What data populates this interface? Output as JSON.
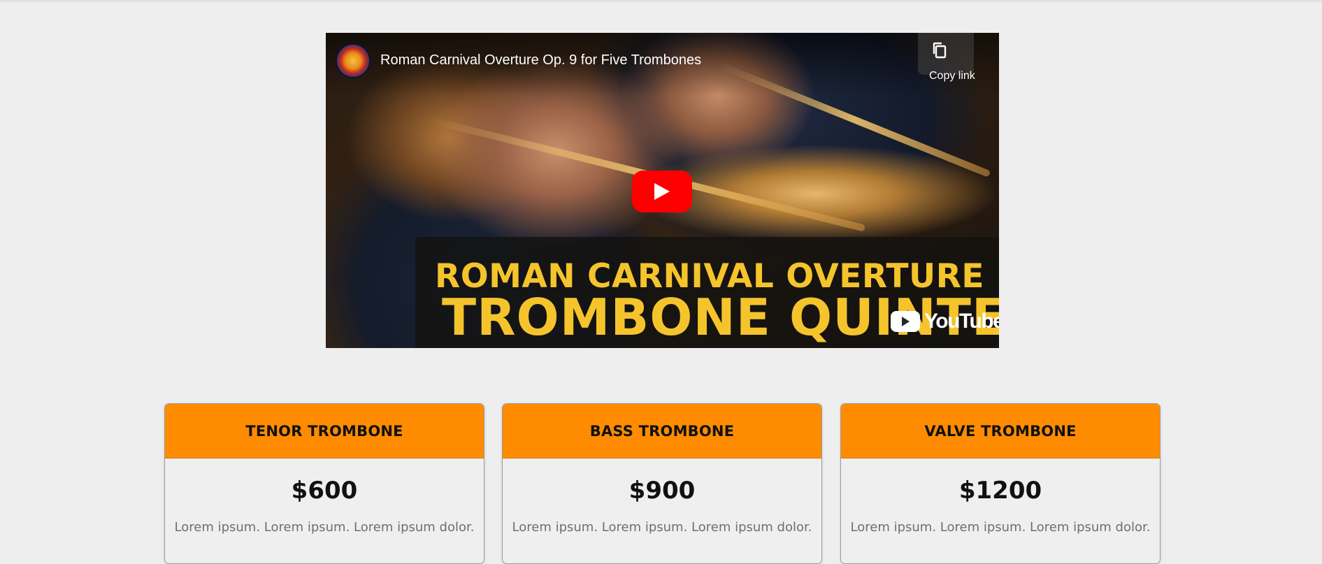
{
  "video": {
    "title": "Roman Carnival Overture Op. 9 for Five Trombones",
    "copy_link_label": "Copy link",
    "caption_line1": "ROMAN CARNIVAL OVERTURE",
    "caption_line2": "TROMBONE QUINTET",
    "youtube_wordmark": "YouTube",
    "icons": {
      "channel": "channel-logo",
      "copy": "copy-icon",
      "play": "play-icon",
      "youtube": "youtube-logo-icon"
    },
    "colors": {
      "play_button": "#ff0000",
      "caption_text": "#f5c42c"
    }
  },
  "pricing": {
    "colors": {
      "header": "#ff8c00",
      "card_background": "#efefef"
    },
    "cards": [
      {
        "name": "TENOR TROMBONE",
        "price": "$600",
        "description": "Lorem ipsum. Lorem ipsum. Lorem ipsum dolor."
      },
      {
        "name": "BASS TROMBONE",
        "price": "$900",
        "description": "Lorem ipsum. Lorem ipsum. Lorem ipsum dolor."
      },
      {
        "name": "VALVE TROMBONE",
        "price": "$1200",
        "description": "Lorem ipsum. Lorem ipsum. Lorem ipsum dolor."
      }
    ]
  }
}
